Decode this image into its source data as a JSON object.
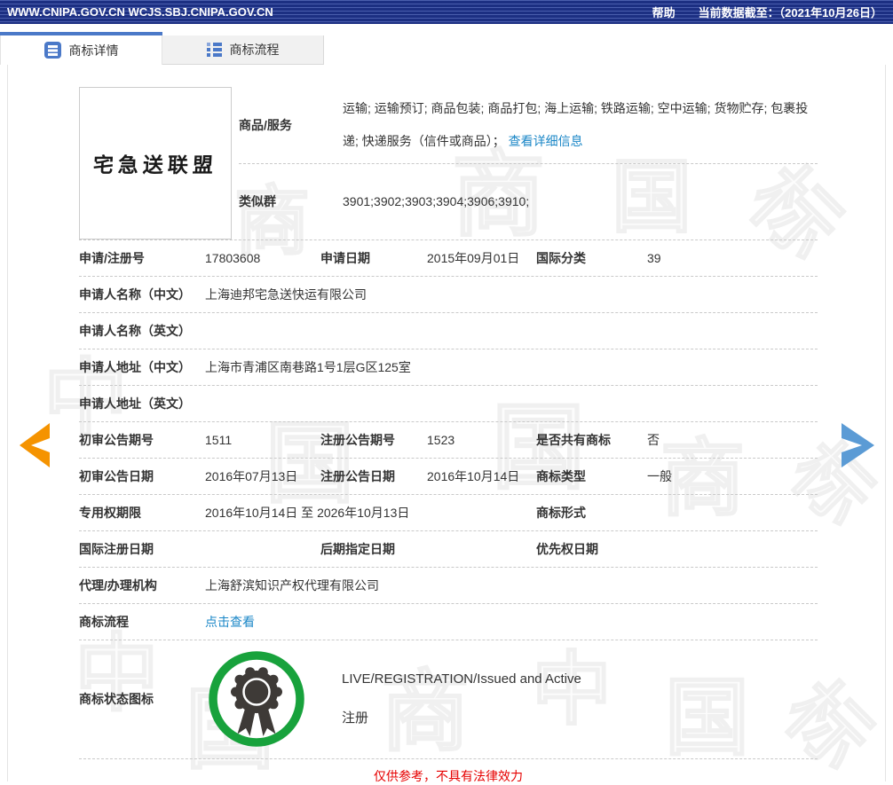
{
  "header": {
    "domain_text": "WWW.CNIPA.GOV.CN WCJS.SBJ.CNIPA.GOV.CN",
    "help": "帮助",
    "data_cutoff": "当前数据截至：（2021年10月26日）"
  },
  "tabs": {
    "detail": "商标详情",
    "process": "商标流程"
  },
  "trademark_image": {
    "text": "宅急送联盟"
  },
  "goods": {
    "label": "商品/服务",
    "value": "运输; 运输预订; 商品包装; 商品打包; 海上运输; 铁路运输; 空中运输; 货物贮存; 包裹投递; 快递服务（信件或商品）；",
    "link": "查看详细信息"
  },
  "similar_group": {
    "label": "类似群",
    "value": "3901;3902;3903;3904;3906;3910;"
  },
  "fields": {
    "reg_no": {
      "label": "申请/注册号",
      "value": "17803608"
    },
    "app_date": {
      "label": "申请日期",
      "value": "2015年09月01日"
    },
    "intl_class": {
      "label": "国际分类",
      "value": "39"
    },
    "applicant_cn": {
      "label": "申请人名称（中文）",
      "value": "上海迪邦宅急送快运有限公司"
    },
    "applicant_en": {
      "label": "申请人名称（英文）",
      "value": ""
    },
    "address_cn": {
      "label": "申请人地址（中文）",
      "value": "上海市青浦区南巷路1号1层G区125室"
    },
    "address_en": {
      "label": "申请人地址（英文）",
      "value": ""
    },
    "first_gazette_no": {
      "label": "初审公告期号",
      "value": "1511"
    },
    "reg_gazette_no": {
      "label": "注册公告期号",
      "value": "1523"
    },
    "is_shared": {
      "label": "是否共有商标",
      "value": "否"
    },
    "first_gazette_date": {
      "label": "初审公告日期",
      "value": "2016年07月13日"
    },
    "reg_gazette_date": {
      "label": "注册公告日期",
      "value": "2016年10月14日"
    },
    "tm_type": {
      "label": "商标类型",
      "value": "一般"
    },
    "exclusive_period": {
      "label": "专用权期限",
      "value": "2016年10月14日 至 2026年10月13日"
    },
    "tm_form": {
      "label": "商标形式",
      "value": ""
    },
    "intl_reg_date": {
      "label": "国际注册日期",
      "value": ""
    },
    "late_designation": {
      "label": "后期指定日期",
      "value": ""
    },
    "priority_date": {
      "label": "优先权日期",
      "value": ""
    },
    "agent": {
      "label": "代理/办理机构",
      "value": "上海舒滨知识产权代理有限公司"
    },
    "process": {
      "label": "商标流程",
      "link": "点击查看"
    }
  },
  "status": {
    "label": "商标状态图标",
    "line1": "LIVE/REGISTRATION/Issued and Active",
    "line2": "注册"
  },
  "footer": {
    "disclaimer": "仅供参考，不具有法律效力"
  },
  "watermark": {
    "chars": [
      "中",
      "国",
      "商",
      "标"
    ]
  },
  "colors": {
    "header_bg": "#1c2f82",
    "tab_accent": "#4b79c8",
    "link_blue": "#1b87c7",
    "status_green": "#18a23c",
    "medal_dark": "#3e3a37",
    "arrow_orange": "#f59300",
    "arrow_blue": "#5b9bd5",
    "disclaimer_red": "#e60000"
  }
}
